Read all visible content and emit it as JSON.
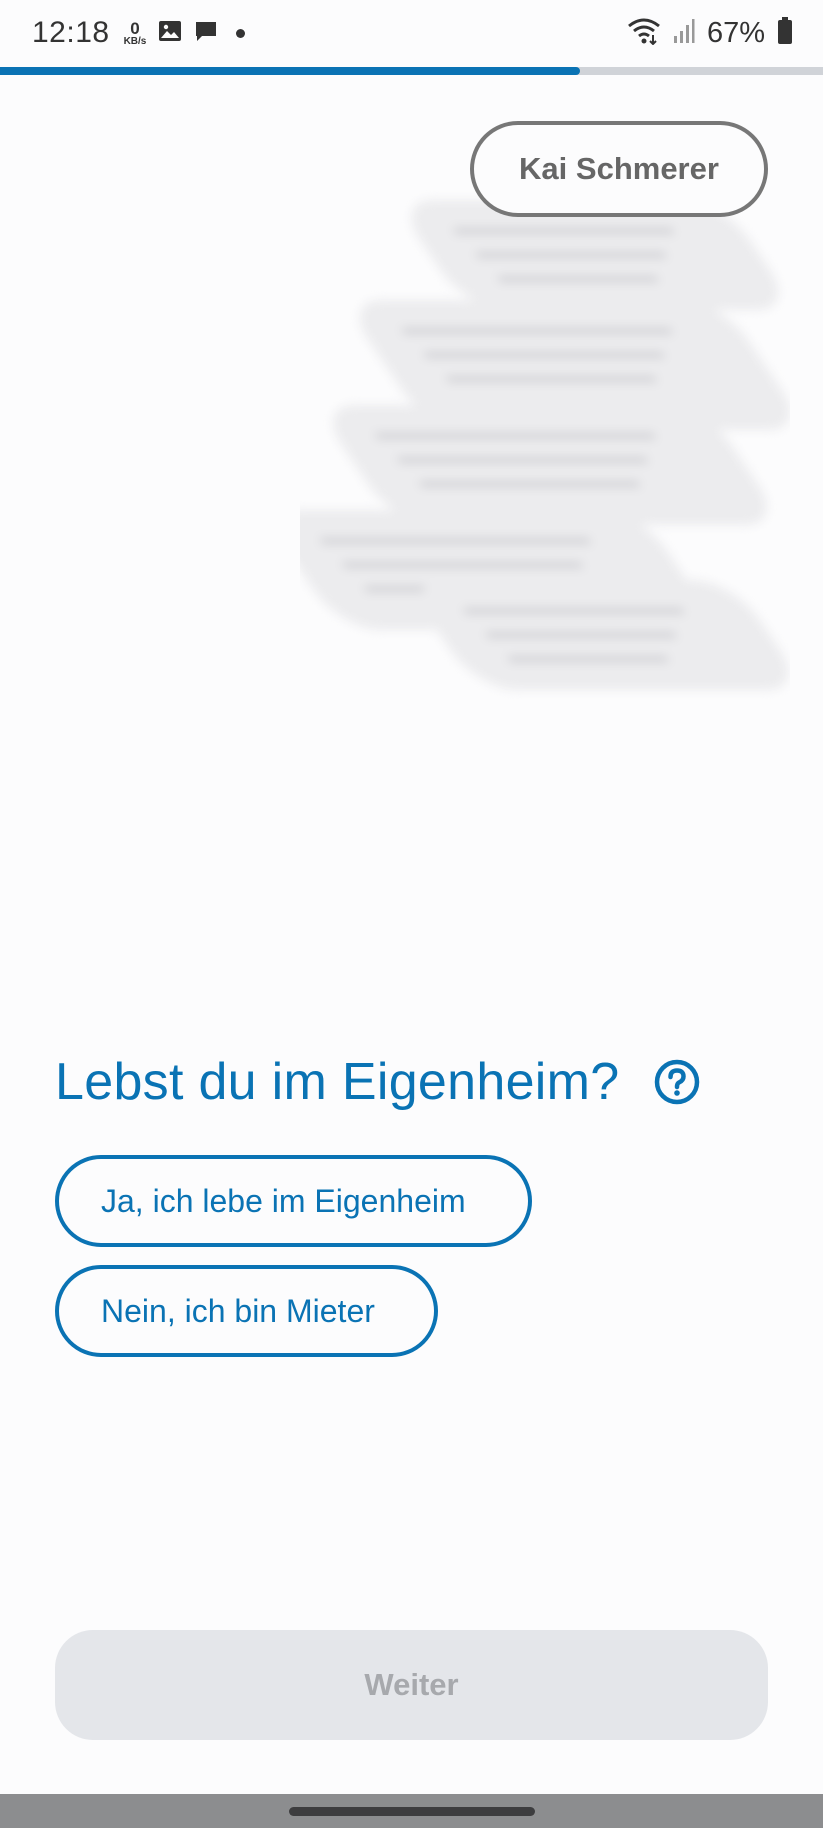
{
  "status_bar": {
    "time": "12:18",
    "net_speed_value": "0",
    "net_speed_unit": "KB/s",
    "battery_percent": "67%",
    "icons": [
      "gallery-icon",
      "message-icon",
      "notification-dot",
      "wifi-icon",
      "signal-icon",
      "battery-icon"
    ]
  },
  "progress": {
    "fraction": 0.705,
    "color": "#0a73b4"
  },
  "speaker": {
    "name": "Kai Schmerer"
  },
  "question": {
    "title": "Lebst du im Eigenheim?",
    "help_icon": "question-circle-icon"
  },
  "options": [
    {
      "label": "Ja, ich lebe im Eigenheim"
    },
    {
      "label": "Nein, ich bin Mieter"
    }
  ],
  "next_button": {
    "label": "Weiter",
    "enabled": false
  },
  "colors": {
    "accent": "#0a73b4",
    "background": "#fcfcfd",
    "disabled": "#e4e6ea"
  }
}
